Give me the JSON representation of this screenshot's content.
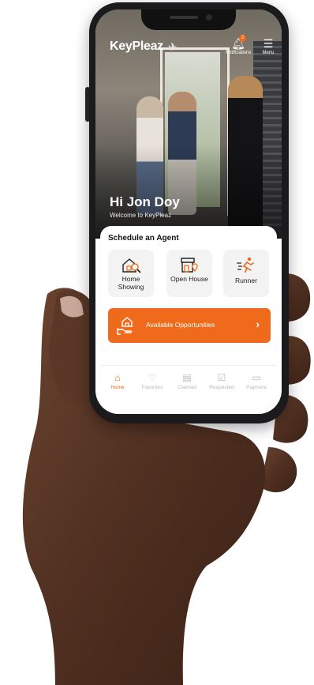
{
  "app": {
    "brand": "KeyPleaz",
    "accent_color": "#ef6a1a"
  },
  "header": {
    "notifications_label": "Notifications",
    "notifications_count": "2",
    "menu_label": "Menu"
  },
  "greeting": {
    "title": "Hi Jon Doy",
    "subtitle": "Welcome to KeyPleaz"
  },
  "schedule": {
    "title": "Schedule an Agent",
    "tiles": [
      {
        "label": "Home Showing",
        "icon": "house-search-icon"
      },
      {
        "label": "Open House",
        "icon": "open-house-icon"
      },
      {
        "label": "Runner",
        "icon": "runner-icon"
      }
    ]
  },
  "opportunities": {
    "label": "Available Opportunities",
    "icon": "hand-house-icon"
  },
  "tabs": [
    {
      "label": "Home",
      "icon": "home-icon",
      "active": true
    },
    {
      "label": "Favorites",
      "icon": "heart-icon",
      "active": false
    },
    {
      "label": "Claimed",
      "icon": "document-icon",
      "active": false
    },
    {
      "label": "Requested",
      "icon": "check-message-icon",
      "active": false
    },
    {
      "label": "Payment",
      "icon": "wallet-icon",
      "active": false
    }
  ]
}
